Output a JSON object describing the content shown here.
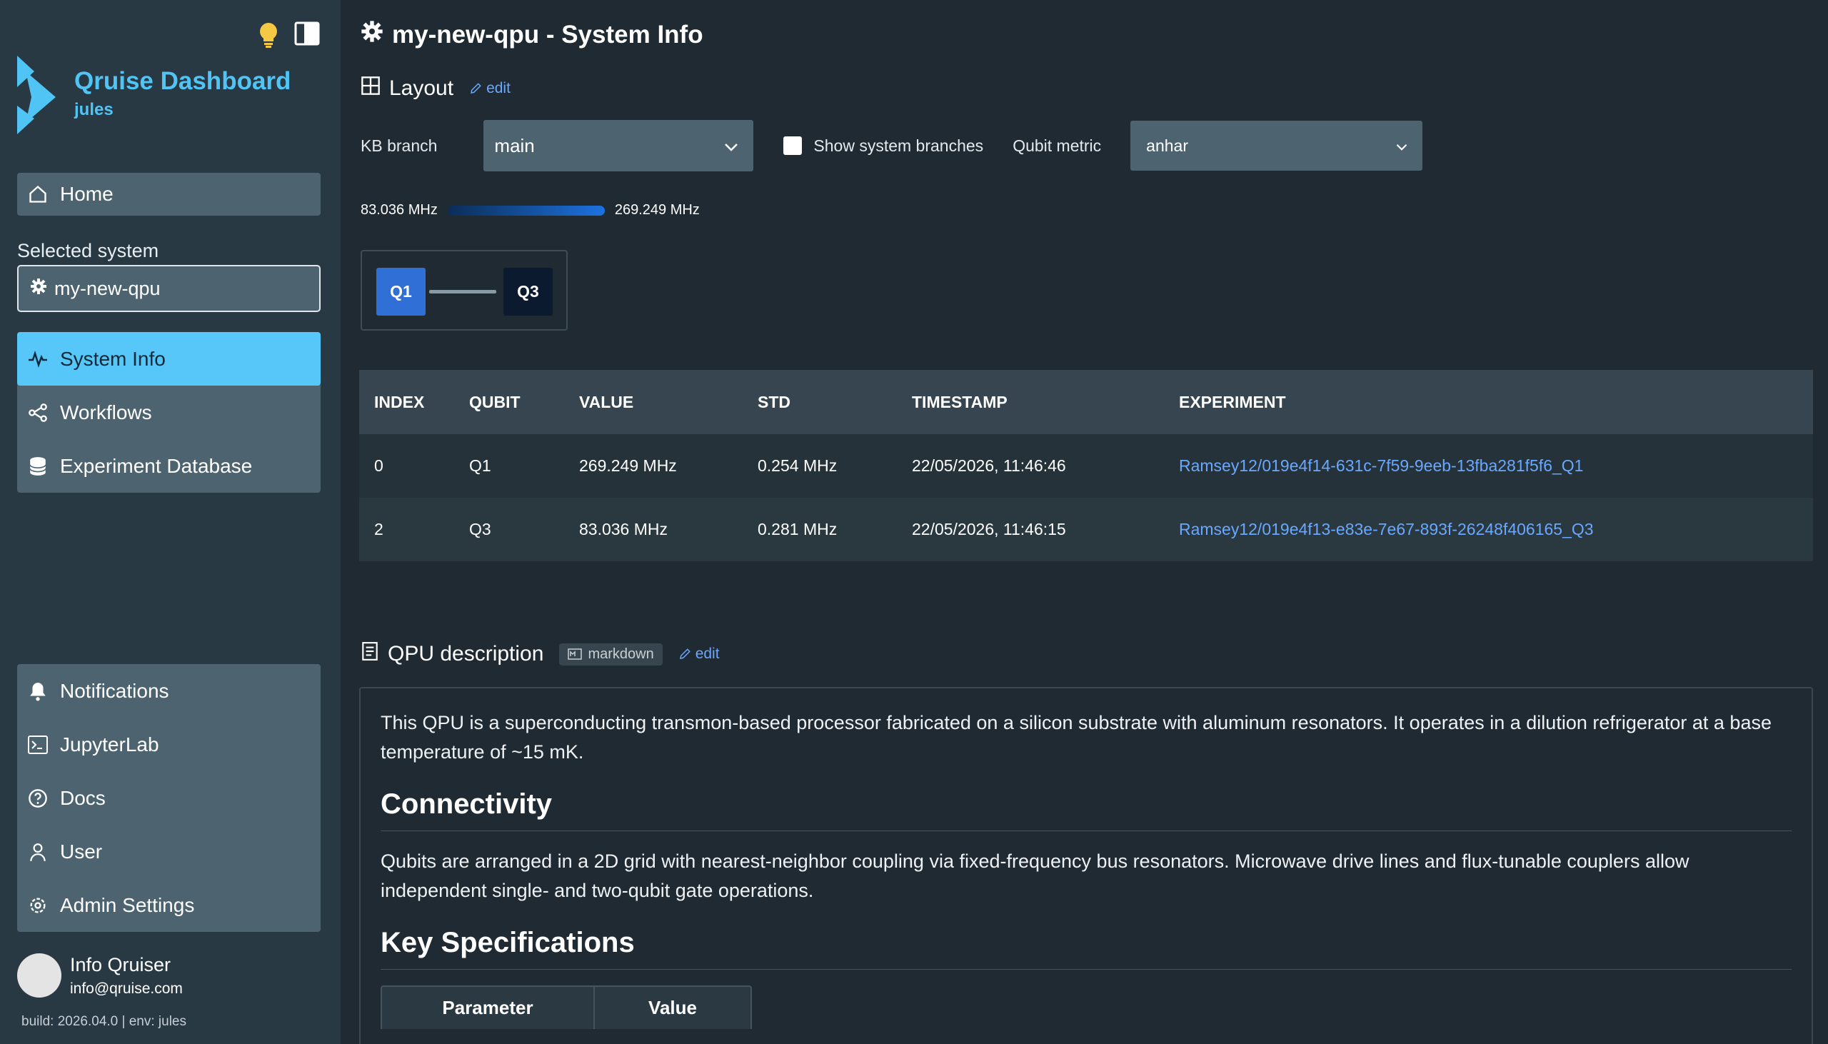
{
  "sidebar": {
    "app_title": "Qruise Dashboard",
    "app_subtitle": "jules",
    "home_label": "Home",
    "selected_system_label": "Selected system",
    "selected_system_value": "my-new-qpu",
    "nav_items": [
      "System Info",
      "Workflows",
      "Experiment Database"
    ],
    "bottom_items": [
      "Notifications",
      "JupyterLab",
      "Docs",
      "User",
      "Admin Settings"
    ],
    "user_name": "Info Qruiser",
    "user_email": "info@qruise.com",
    "build": "build: 2026.04.0 | env: jules"
  },
  "main": {
    "title": "my-new-qpu - System Info",
    "layout_heading": "Layout",
    "edit_label": "edit",
    "kb_branch_label": "KB branch",
    "kb_branch_value": "main",
    "show_system_branches_label": "Show system branches",
    "qubit_metric_label": "Qubit metric",
    "qubit_metric_value": "anhar",
    "scale_min": "83.036 MHz",
    "scale_max": "269.249 MHz",
    "qubits": [
      "Q1",
      "Q3"
    ]
  },
  "table": {
    "headers": [
      "INDEX",
      "QUBIT",
      "VALUE",
      "STD",
      "TIMESTAMP",
      "EXPERIMENT"
    ],
    "rows": [
      [
        "0",
        "Q1",
        "269.249 MHz",
        "0.254 MHz",
        "22/05/2026, 11:46:46",
        "Ramsey12/019e4f14-631c-7f59-9eeb-13fba281f5f6_Q1"
      ],
      [
        "2",
        "Q3",
        "83.036 MHz",
        "0.281 MHz",
        "22/05/2026, 11:46:15",
        "Ramsey12/019e4f13-e83e-7e67-893f-26248f406165_Q3"
      ]
    ]
  },
  "description": {
    "heading": "QPU description",
    "format_badge": "markdown",
    "edit_label": "edit",
    "intro": "This QPU is a superconducting transmon-based processor fabricated on a silicon substrate with aluminum resonators. It operates in a dilution refrigerator at a base temperature of ~15 mK.",
    "connectivity_heading": "Connectivity",
    "connectivity_text": "Qubits are arranged in a 2D grid with nearest-neighbor coupling via fixed-frequency bus resonators. Microwave drive lines and flux-tunable couplers allow independent single- and two-qubit gate operations.",
    "specs_heading": "Key Specifications",
    "spec_headers": [
      "Parameter",
      "Value"
    ]
  },
  "colors": {
    "accent": "#56c7f8",
    "link": "#6aa8ff",
    "q1_node": "#2f6fd6",
    "q3_node": "#0b1a2e"
  }
}
